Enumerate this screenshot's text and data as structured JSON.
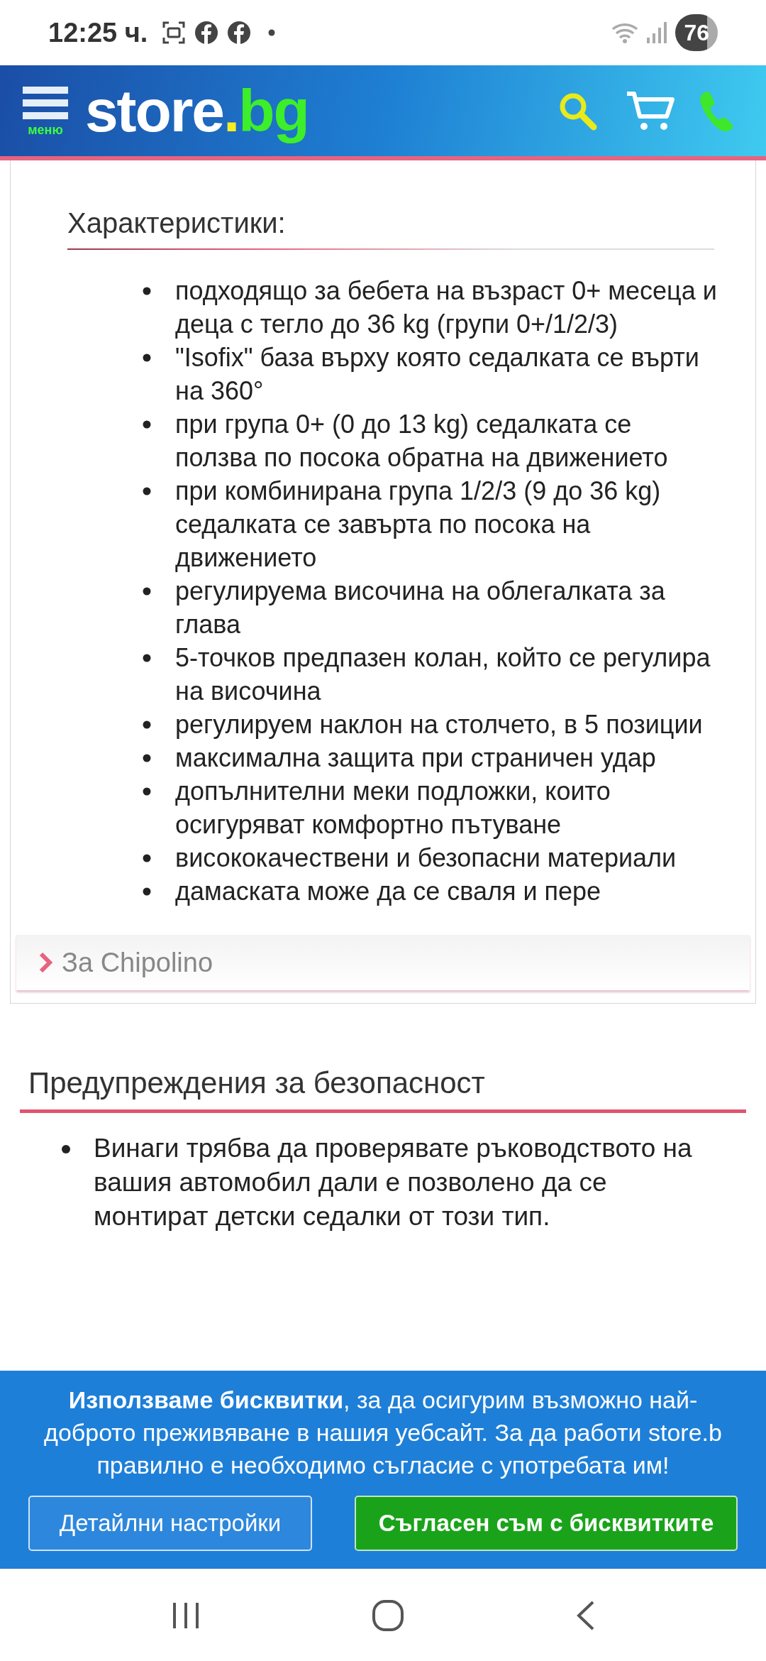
{
  "status_bar": {
    "time": "12:25 ч.",
    "battery": "76"
  },
  "header": {
    "menu_label": "меню",
    "logo": {
      "name": "store",
      "dot": ".",
      "tld": "bg"
    }
  },
  "features": {
    "title": "Характеристики:",
    "items": [
      "подходящо за бебета на възраст 0+ месеца и деца с тегло до 36 kg (групи 0+/1/2/3)",
      "\"Isofix\" база върху която седалката се върти на 360°",
      "при група 0+ (0 до 13 kg) седалката се ползва по посока обратна на движението",
      "при комбинирана група 1/2/3 (9 до 36 kg) седалката се завърта по посока на движението",
      "регулируема височина на облегалката за глава",
      "5-точков предпазен колан, който се регулира на височина",
      "регулируем наклон на столчето, в 5 позиции",
      "максимална защита при страничен удар",
      "допълнителни меки подложки, които осигуряват комфортно пътуване",
      "висококачествени и безопасни материали",
      "дамаската може да се сваля и пере"
    ]
  },
  "accordion": {
    "label": "За Chipolino",
    "expanded": false
  },
  "safety": {
    "title": "Предупреждения за безопасност",
    "items": [
      "Винаги трябва да проверявате ръководството на вашия автомобил дали е позволено да се монтират детски седалки от този тип."
    ]
  },
  "cookie_banner": {
    "message": "**Използваме бисквитки**, за да осигурим възможно най-доброто преживяване в нашия уебсайт. За да работи store.b",
    "message_end": "правилно е необходимо съгласие с употребата им!",
    "buttons": [
      {
        "label": "Детайлни настройки",
        "kind": "secondary"
      },
      {
        "label": "Съгласен съм с бисквитките",
        "kind": "primary"
      }
    ]
  }
}
